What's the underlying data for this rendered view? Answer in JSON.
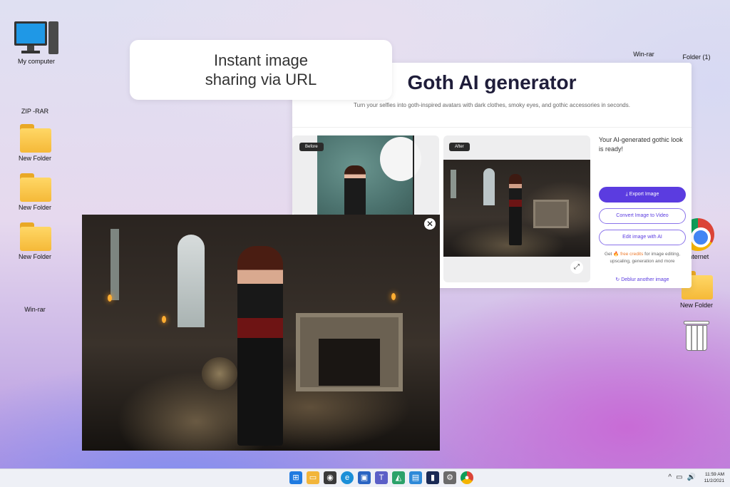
{
  "desktop": {
    "left_icons": [
      {
        "label": "My computer",
        "icon": "computer-icon"
      },
      {
        "label": "ZIP -RAR",
        "icon": "binder-icon"
      },
      {
        "label": "New Folder",
        "icon": "folder-icon"
      },
      {
        "label": "New Folder",
        "icon": "folder-icon"
      },
      {
        "label": "New Folder",
        "icon": "folder-icon"
      },
      {
        "label": "Win-rar",
        "icon": "winrar-icon"
      }
    ],
    "right_icons": [
      {
        "label": "Win-rar",
        "icon": "winrar-icon"
      },
      {
        "label": "Folder (1)",
        "icon": "binder-icon"
      },
      {
        "label": "Internet",
        "icon": "chrome-icon"
      },
      {
        "label": "New Folder",
        "icon": "folder-icon"
      },
      {
        "label": "",
        "icon": "recycle-bin-icon"
      }
    ]
  },
  "caption": {
    "text": "Instant image\nsharing via URL"
  },
  "app": {
    "title": "Goth AI generator",
    "subtitle": "Turn your selfies into goth-inspired avatars with dark clothes, smoky eyes, and gothic accessories in seconds.",
    "before_tag": "Before",
    "after_tag": "After",
    "ready_text": "Your AI-generated gothic look is ready!",
    "export_label": "Export Image",
    "convert_label": "Convert Image to Video",
    "edit_label": "Edit image with AI",
    "credits_prefix": "Get",
    "credits_link": "free credits",
    "credits_suffix": "for image editing, upscaling, generation and more",
    "deblur_label": "Deblur another image"
  },
  "preview": {
    "close_symbol": "✕"
  },
  "taskbar": {
    "apps": [
      "windows-start-icon",
      "file-explorer-icon",
      "camera-icon",
      "edge-icon",
      "store-icon",
      "teams-icon",
      "photos-icon",
      "news-icon",
      "app-icon",
      "settings-icon",
      "chrome-icon"
    ],
    "tray_chevron": "^",
    "time": "11:59 AM",
    "date": "11/2/2021"
  },
  "colors": {
    "accent": "#5b3ce0",
    "credits_highlight": "#ee7a2c"
  }
}
